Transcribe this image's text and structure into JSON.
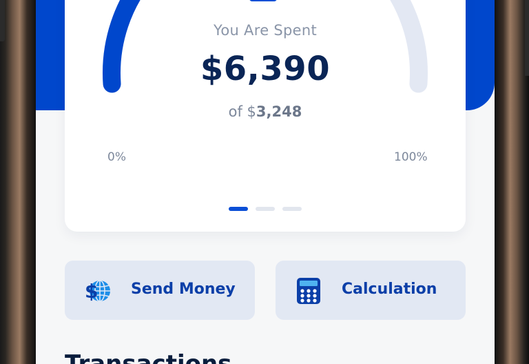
{
  "spending": {
    "title": "You Are Spent",
    "amount": "$6,390",
    "of_prefix": "of $",
    "of_value": "3,248",
    "min_label": "0%",
    "max_label": "100%",
    "progress": 0.5
  },
  "carousel": {
    "count": 3,
    "active_index": 0
  },
  "actions": [
    {
      "label": "Send Money",
      "icon": "dollar-globe-icon"
    },
    {
      "label": "Calculation",
      "icon": "calculator-icon"
    }
  ],
  "section": {
    "heading": "Transactions"
  },
  "colors": {
    "accent": "#0047CC",
    "gauge_track": "#E3E8F3",
    "card_bg": "#FFFFFF",
    "action_bg": "#E2E8F3",
    "heading": "#0A1D3D"
  }
}
